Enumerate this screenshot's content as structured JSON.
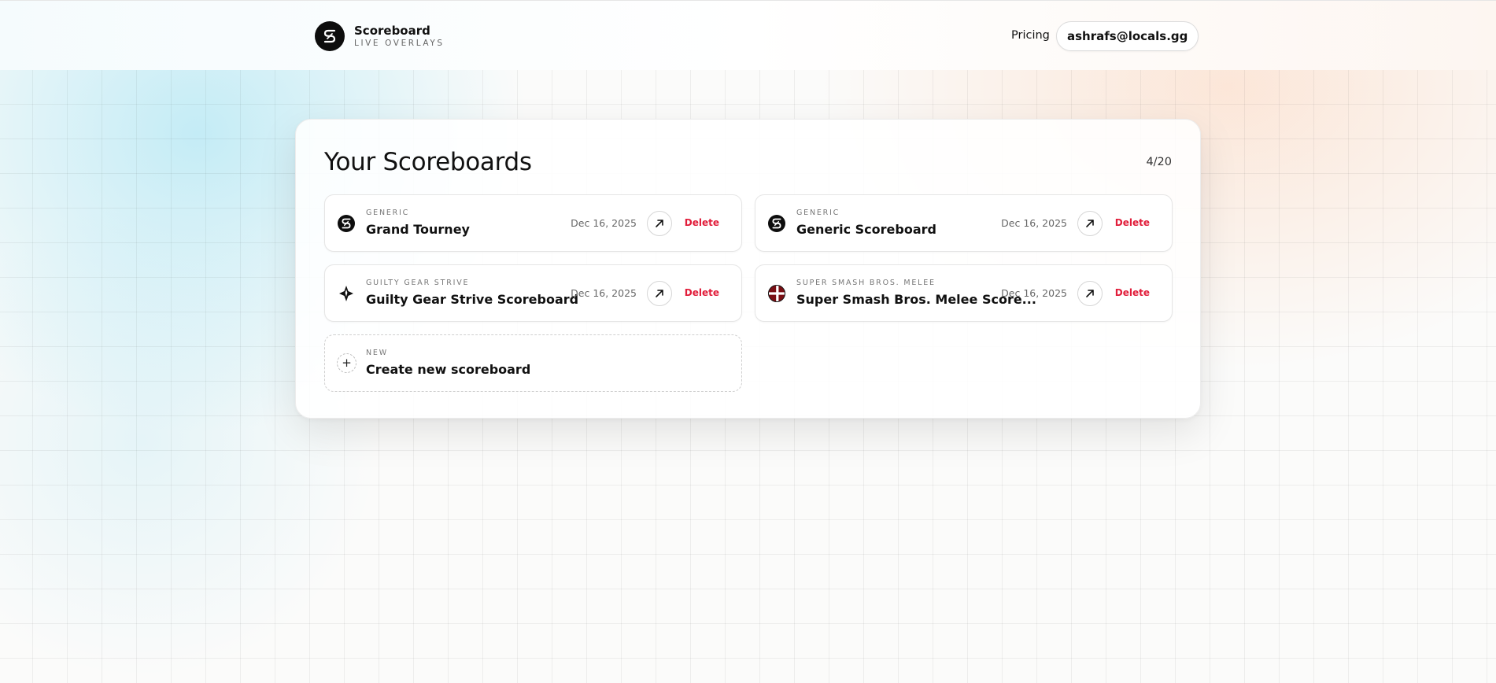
{
  "header": {
    "brand_name": "Scoreboard",
    "brand_tagline": "LIVE OVERLAYS",
    "brand_logo_icon": "scoreboard-s-logo-icon",
    "nav_pricing": "Pricing",
    "account_email": "ashrafs@locals.gg"
  },
  "main": {
    "title": "Your Scoreboards",
    "count": "4/20",
    "scoreboards": [
      {
        "category": "GENERIC",
        "name": "Grand Tourney",
        "date": "Dec 16, 2025",
        "icon": "scoreboard-s-logo-icon",
        "delete_label": "Delete",
        "open_icon": "arrow-up-right-icon"
      },
      {
        "category": "GENERIC",
        "name": "Generic Scoreboard",
        "date": "Dec 16, 2025",
        "icon": "scoreboard-s-logo-icon",
        "delete_label": "Delete",
        "open_icon": "arrow-up-right-icon"
      },
      {
        "category": "GUILTY GEAR STRIVE",
        "name": "Guilty Gear Strive Scoreboard",
        "date": "Dec 16, 2025",
        "icon": "guilty-gear-strive-logo-icon",
        "delete_label": "Delete",
        "open_icon": "arrow-up-right-icon"
      },
      {
        "category": "SUPER SMASH BROS. MELEE",
        "name": "Super Smash Bros. Melee Score...",
        "date": "Dec 16, 2025",
        "icon": "smash-bros-logo-icon",
        "delete_label": "Delete",
        "open_icon": "arrow-up-right-icon"
      }
    ],
    "create_new": {
      "category": "NEW",
      "label": "Create new scoreboard",
      "icon": "plus-icon"
    }
  },
  "colors": {
    "delete": "#e11d3a",
    "accent_cyan": "#78d7f0",
    "accent_peach": "#fccdaf"
  }
}
